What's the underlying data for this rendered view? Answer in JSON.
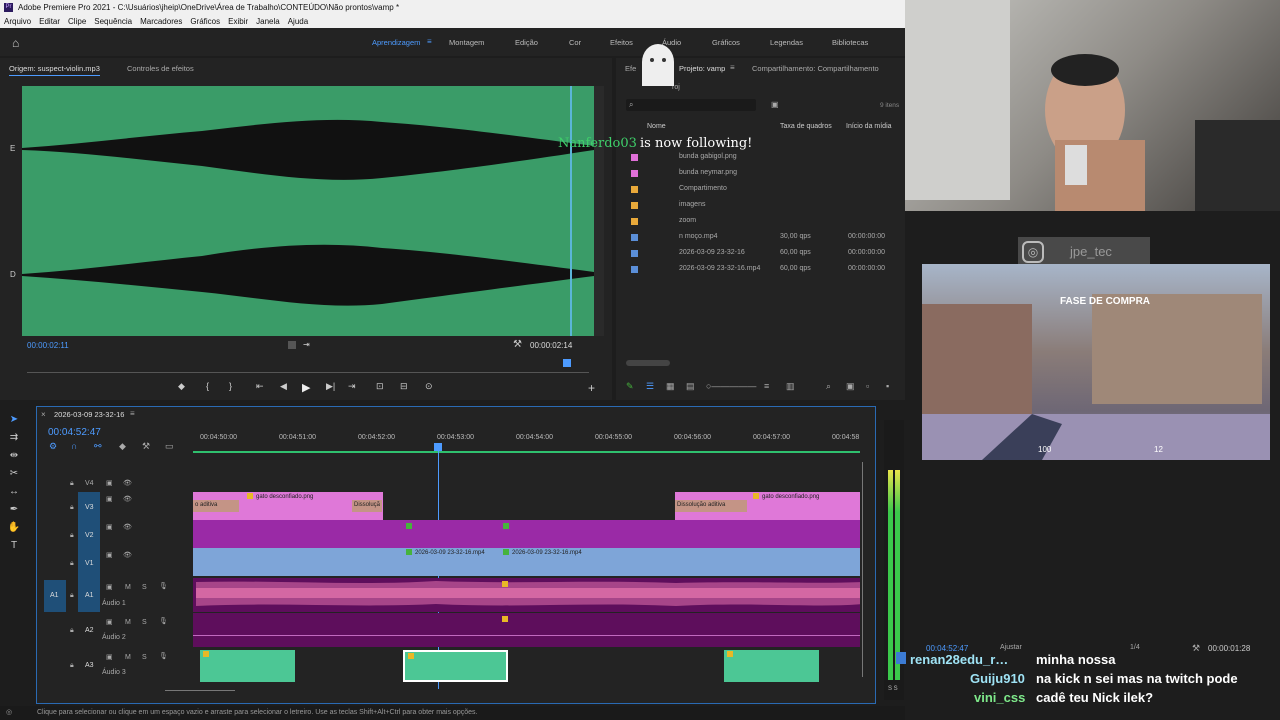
{
  "app": {
    "title": "Adobe Premiere Pro 2021 - C:\\Usuários\\jheip\\OneDrive\\Área de Trabalho\\CONTEÚDO\\Não prontos\\vamp *",
    "menu": [
      "Arquivo",
      "Editar",
      "Clipe",
      "Sequência",
      "Marcadores",
      "Gráficos",
      "Exibir",
      "Janela",
      "Ajuda"
    ]
  },
  "workspaces": {
    "items": [
      "Aprendizagem",
      "Montagem",
      "Edição",
      "Cor",
      "Efeitos",
      "Áudio",
      "Gráficos",
      "Legendas",
      "Bibliotecas"
    ],
    "active": "Aprendizagem"
  },
  "source": {
    "tab_active": "Origem: suspect-violin.mp3",
    "tab_other": "Controles de efeitos",
    "timecode_in": "00:00:02:11",
    "timecode_dur": "00:00:02:14",
    "ch_top": "E",
    "ch_bottom": "D"
  },
  "project": {
    "tab_effects": "Efe",
    "tab_active": "Projeto: vamp",
    "tab_shared": "Compartilhamento: Compartilhamento",
    "file": "roj",
    "count": "9 itens",
    "col_name": "Nome",
    "col_rate": "Taxa de quadros",
    "col_start": "Início da mídia",
    "items": [
      {
        "name": "bunda gabigol.png",
        "rate": "",
        "start": "",
        "color": "#e070d8"
      },
      {
        "name": "bunda neymar.png",
        "rate": "",
        "start": "",
        "color": "#e070d8"
      },
      {
        "name": "Compartimento",
        "rate": "",
        "start": "",
        "color": "#e9a93a"
      },
      {
        "name": "imagens",
        "rate": "",
        "start": "",
        "color": "#e9a93a"
      },
      {
        "name": "zoom",
        "rate": "",
        "start": "",
        "color": "#e9a93a"
      },
      {
        "name": "n moço.mp4",
        "rate": "30,00 qps",
        "start": "00:00:00:00",
        "color": "#5b8fd8"
      },
      {
        "name": "2026-03-09 23-32-16",
        "rate": "60,00 qps",
        "start": "00:00:00:00",
        "color": "#5b8fd8"
      },
      {
        "name": "2026-03-09 23-32-16.mp4",
        "rate": "60,00 qps",
        "start": "00:00:00:00",
        "color": "#5b8fd8"
      }
    ]
  },
  "overlay": {
    "follow_user": "Nanferdo03",
    "follow_text": "is now following!",
    "insta": "jpe_tec",
    "game_banner": "FASE DE COMPRA",
    "game_hp": "100",
    "game_ammo": "12"
  },
  "program": {
    "timecode": "00:04:52:47",
    "fit": "Ajustar",
    "ratio": "1/4",
    "duration": "00:00:01:28"
  },
  "timeline": {
    "sequence": "2026-03-09 23-32-16",
    "timecode": "00:04:52:47",
    "ruler": [
      "00:04:50:00",
      "00:04:51:00",
      "00:04:52:00",
      "00:04:53:00",
      "00:04:54:00",
      "00:04:55:00",
      "00:04:56:00",
      "00:04:57:00",
      "00:04:58"
    ],
    "tracks": {
      "v4": "V4",
      "v3": "V3",
      "v2": "V2",
      "v1": "V1",
      "a1": "A1",
      "a2": "A2",
      "a3": "A3",
      "a1_name": "Áudio 1",
      "a2_name": "Áudio 2",
      "a3_name": "Áudio 3",
      "m": "M",
      "s": "S"
    },
    "clips": {
      "v3_a": "o aditiva",
      "v3_b": "gato desconfiado.png",
      "v3_c": "Dissoluçã",
      "v3_d": "Dissolução aditiva",
      "v3_e": "gato desconfiado.png",
      "v1_a": "2026-03-09 23-32-16.mp4",
      "v1_b": "2026-03-09 23-32-16.mp4"
    },
    "meter_label": "S S"
  },
  "status": "Clique para selecionar ou clique em um espaço vazio e arraste para selecionar o letreiro. Use as teclas Shift+Alt+Ctrl para obter mais opções.",
  "chat": [
    {
      "user": "renan28edu_r…",
      "msg": "minha nossa"
    },
    {
      "user": "Guiju910",
      "msg": "na kick n sei mas na twitch pode"
    },
    {
      "user": "vini_css",
      "msg": "cadê teu Nick ilek?"
    }
  ],
  "colors": {
    "accent": "#4d9bff",
    "waveform_bg": "#3a9c68",
    "clip_pink": "#df78d8",
    "clip_purple": "#9a2aa6",
    "clip_blue": "#7ea5d8",
    "audio_pink": "#d86aa6",
    "audio_green": "#4cc795"
  }
}
